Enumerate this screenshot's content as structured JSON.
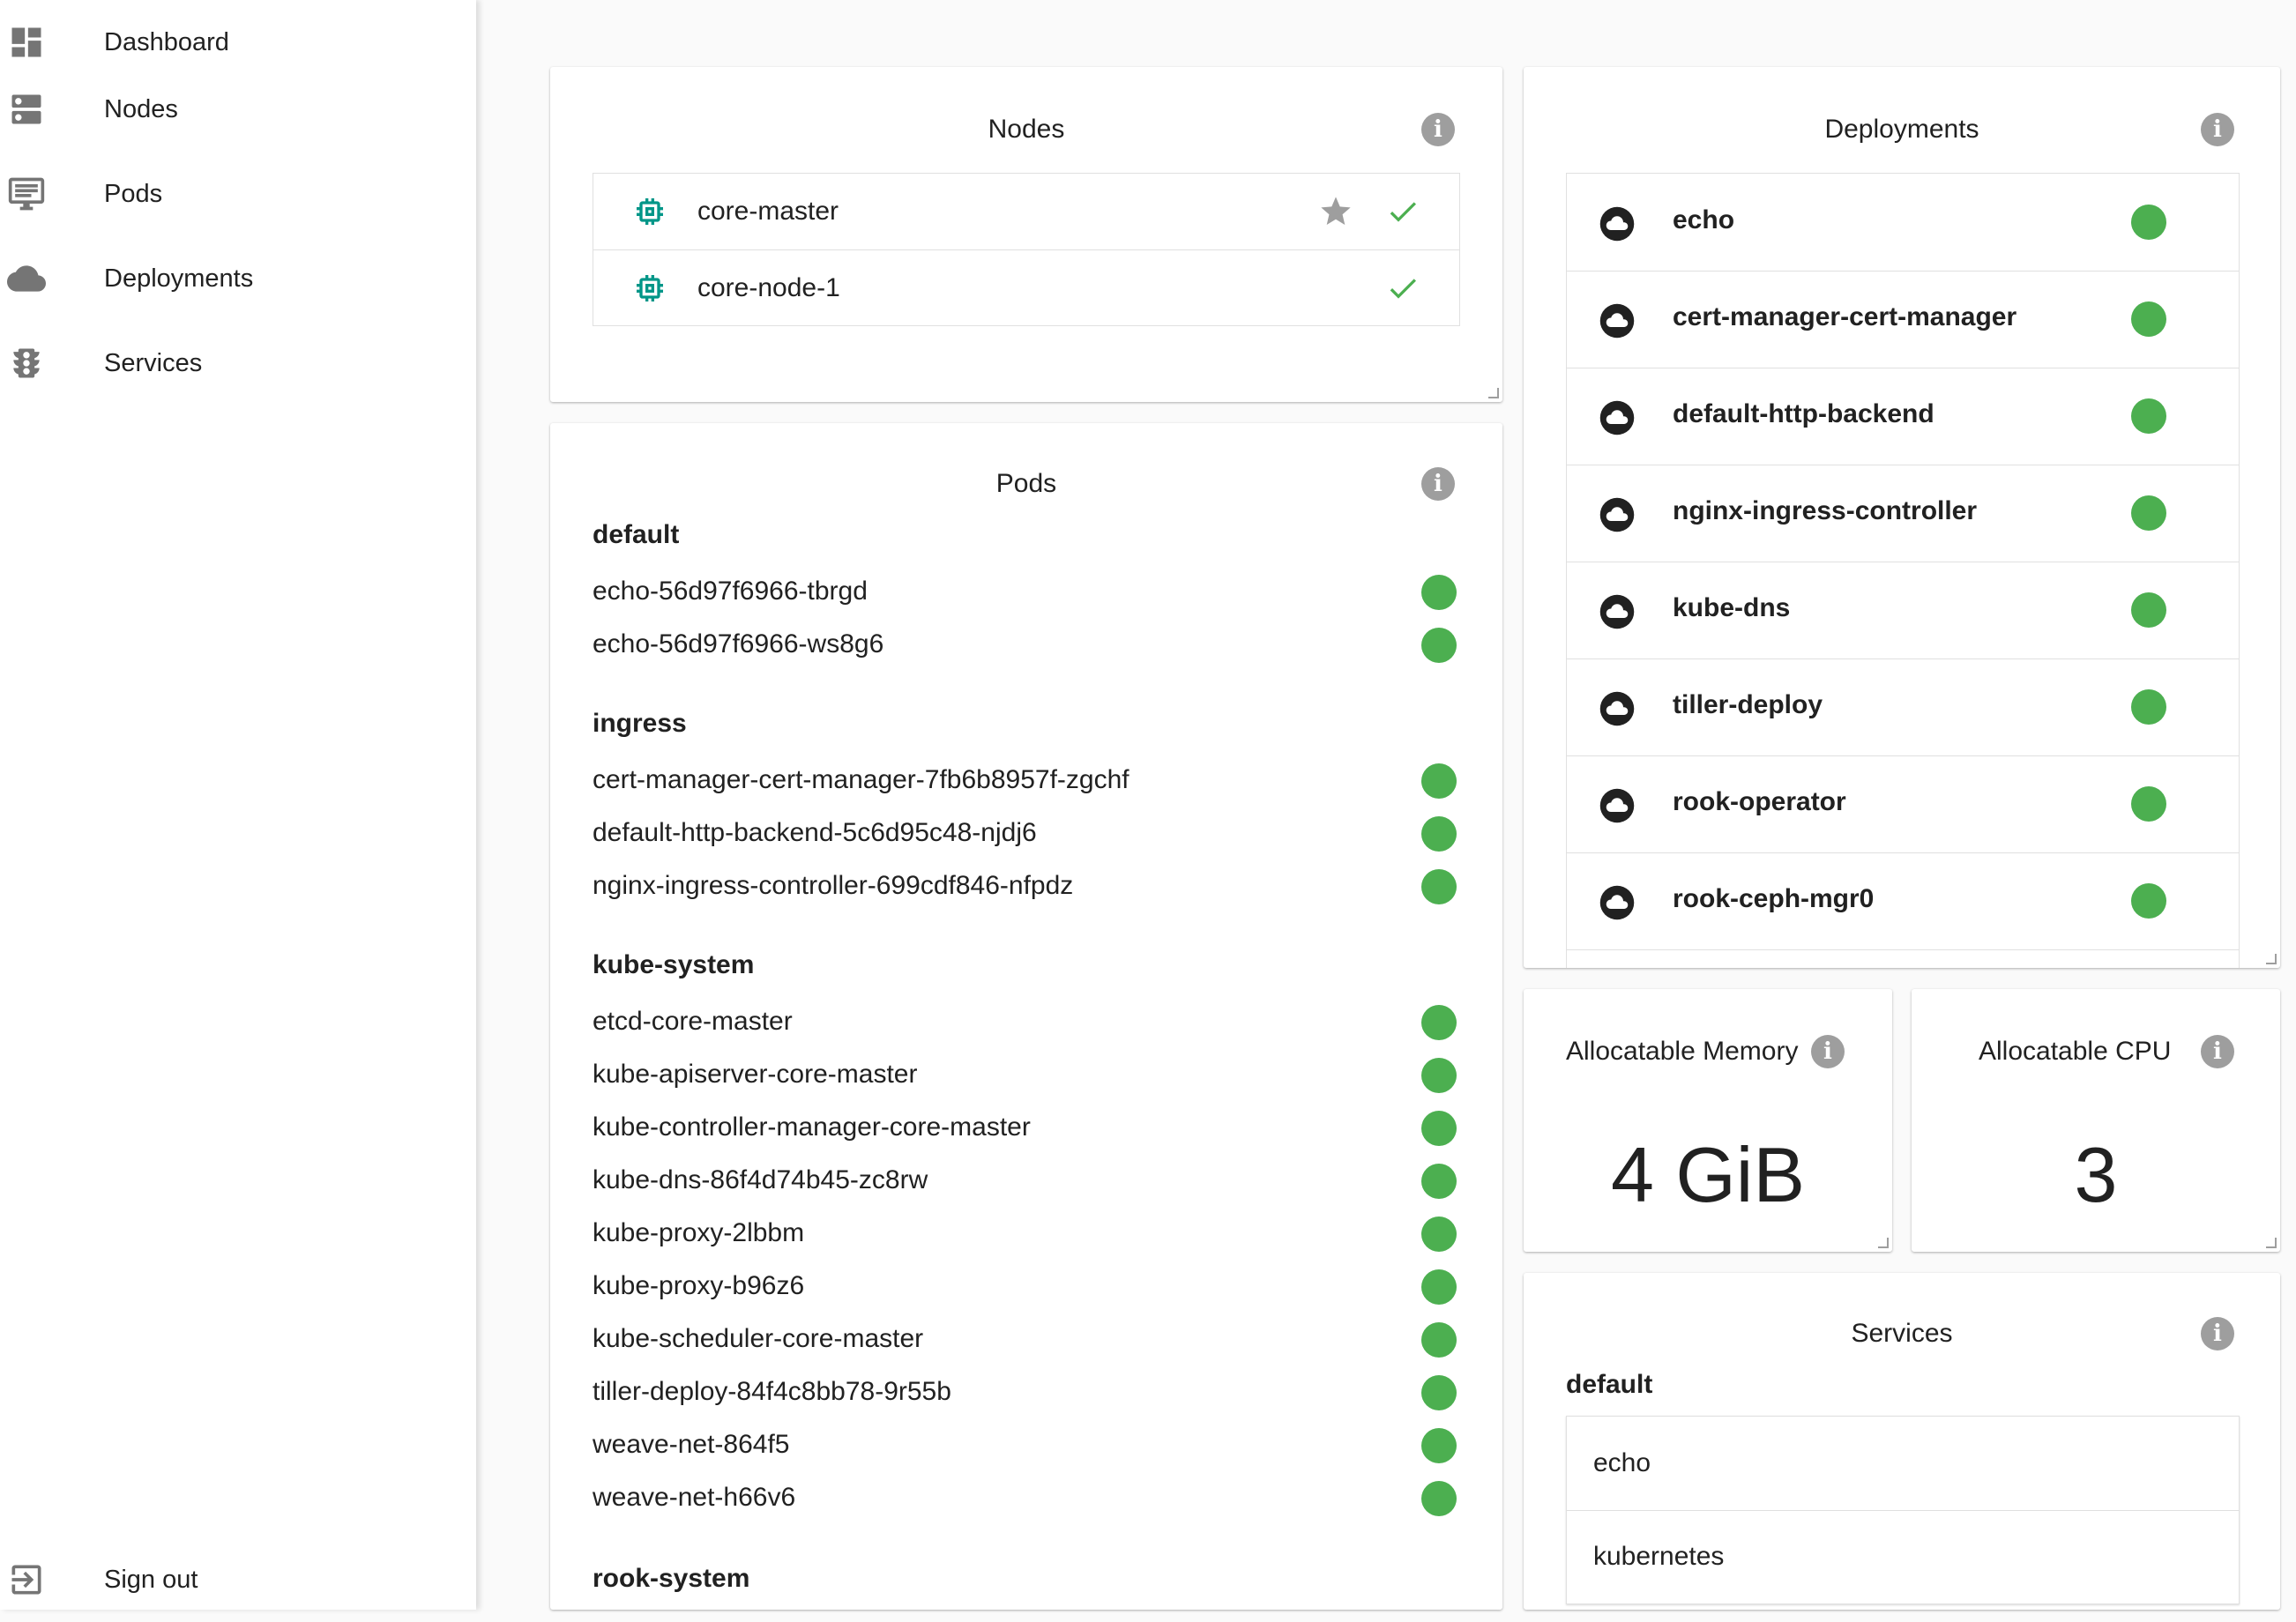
{
  "sidebar": {
    "items": [
      {
        "label": "Dashboard",
        "icon": "dashboard-icon"
      },
      {
        "label": "Nodes",
        "icon": "nodes-icon"
      },
      {
        "label": "Pods",
        "icon": "pods-icon"
      },
      {
        "label": "Deployments",
        "icon": "cloud-icon"
      },
      {
        "label": "Services",
        "icon": "traffic-light-icon"
      }
    ],
    "signout": {
      "label": "Sign out",
      "icon": "sign-out-icon"
    }
  },
  "nodes": {
    "title": "Nodes",
    "items": [
      {
        "name": "core-master",
        "starred": true,
        "ready": true
      },
      {
        "name": "core-node-1",
        "starred": false,
        "ready": true
      }
    ]
  },
  "pods": {
    "title": "Pods",
    "namespaces": [
      {
        "name": "default",
        "pods": [
          "echo-56d97f6966-tbrgd",
          "echo-56d97f6966-ws8g6"
        ]
      },
      {
        "name": "ingress",
        "pods": [
          "cert-manager-cert-manager-7fb6b8957f-zgchf",
          "default-http-backend-5c6d95c48-njdj6",
          "nginx-ingress-controller-699cdf846-nfpdz"
        ]
      },
      {
        "name": "kube-system",
        "pods": [
          "etcd-core-master",
          "kube-apiserver-core-master",
          "kube-controller-manager-core-master",
          "kube-dns-86f4d74b45-zc8rw",
          "kube-proxy-2lbbm",
          "kube-proxy-b96z6",
          "kube-scheduler-core-master",
          "tiller-deploy-84f4c8bb78-9r55b",
          "weave-net-864f5",
          "weave-net-h66v6"
        ]
      },
      {
        "name": "rook-system",
        "pods": []
      }
    ]
  },
  "deployments": {
    "title": "Deployments",
    "items": [
      "echo",
      "cert-manager-cert-manager",
      "default-http-backend",
      "nginx-ingress-controller",
      "kube-dns",
      "tiller-deploy",
      "rook-operator",
      "rook-ceph-mgr0"
    ]
  },
  "memory": {
    "title": "Allocatable Memory",
    "value": "4 GiB"
  },
  "cpu": {
    "title": "Allocatable CPU",
    "value": "3"
  },
  "services": {
    "title": "Services",
    "namespace": "default",
    "items": [
      "echo",
      "kubernetes"
    ]
  },
  "colors": {
    "status_ok": "#4caf50",
    "chip": "#009688",
    "check": "#4caf50",
    "info": "#9e9e9e"
  }
}
